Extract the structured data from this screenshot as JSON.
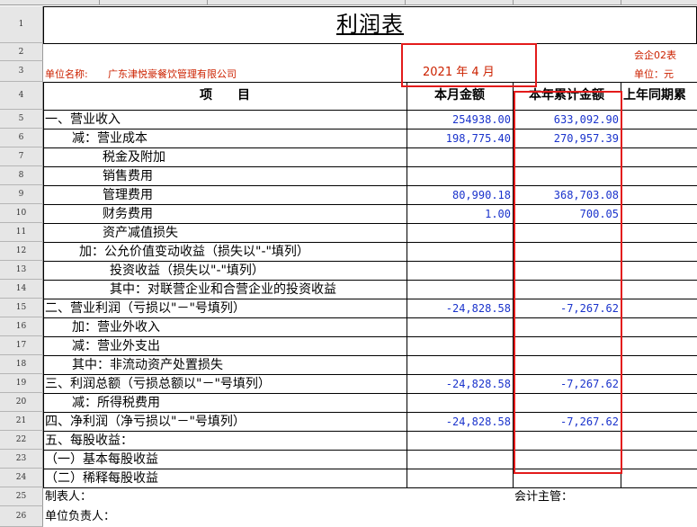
{
  "report": {
    "title": "利润表",
    "form_code": "会企02表",
    "company_label": "单位名称:",
    "company_name": "广东津悦豪餐饮管理有限公司",
    "period": "2021 年 4 月",
    "unit": "单位：元"
  },
  "columns": {
    "item": "项　　目",
    "month": "本月金额",
    "ytd": "本年累计金额",
    "prev": "上年同期累"
  },
  "row_numbers": [
    "1",
    "2",
    "3",
    "4",
    "5",
    "6",
    "7",
    "8",
    "9",
    "10",
    "11",
    "12",
    "13",
    "14",
    "15",
    "16",
    "17",
    "18",
    "19",
    "20",
    "21",
    "22",
    "23",
    "24",
    "25",
    "26"
  ],
  "rows": [
    {
      "label": "一、营业收入",
      "month": "254938.00",
      "ytd": "633,092.90"
    },
    {
      "label": "减：营业成本",
      "month": "198,775.40",
      "ytd": "270,957.39"
    },
    {
      "label": "税金及附加",
      "month": "",
      "ytd": ""
    },
    {
      "label": "销售费用",
      "month": "",
      "ytd": ""
    },
    {
      "label": "管理费用",
      "month": "80,990.18",
      "ytd": "368,703.08"
    },
    {
      "label": "财务费用",
      "month": "1.00",
      "ytd": "700.05"
    },
    {
      "label": "资产减值损失",
      "month": "",
      "ytd": ""
    },
    {
      "label": "加：公允价值变动收益（损失以\"-\"填列）",
      "month": "",
      "ytd": ""
    },
    {
      "label": "投资收益（损失以\"-\"填列）",
      "month": "",
      "ytd": ""
    },
    {
      "label": "其中：对联营企业和合营企业的投资收益",
      "month": "",
      "ytd": ""
    },
    {
      "label": "二、营业利润（亏损以\"－\"号填列）",
      "month": "-24,828.58",
      "ytd": "-7,267.62"
    },
    {
      "label": "加：营业外收入",
      "month": "",
      "ytd": ""
    },
    {
      "label": "减：营业外支出",
      "month": "",
      "ytd": ""
    },
    {
      "label": "其中：非流动资产处置损失",
      "month": "",
      "ytd": ""
    },
    {
      "label": "三、利润总额（亏损总额以\"－\"号填列）",
      "month": "-24,828.58",
      "ytd": "-7,267.62"
    },
    {
      "label": "减：所得税费用",
      "month": "",
      "ytd": ""
    },
    {
      "label": "四、净利润（净亏损以\"－\"号填列）",
      "month": "-24,828.58",
      "ytd": "-7,267.62"
    },
    {
      "label": "五、每股收益：",
      "month": "",
      "ytd": ""
    },
    {
      "label": "（一）基本每股收益",
      "month": "",
      "ytd": ""
    },
    {
      "label": "（二）稀释每股收益",
      "month": "",
      "ytd": ""
    }
  ],
  "footer": {
    "preparer": "制表人：",
    "accountant": "会计主管：",
    "responsible": "单位负责人："
  }
}
